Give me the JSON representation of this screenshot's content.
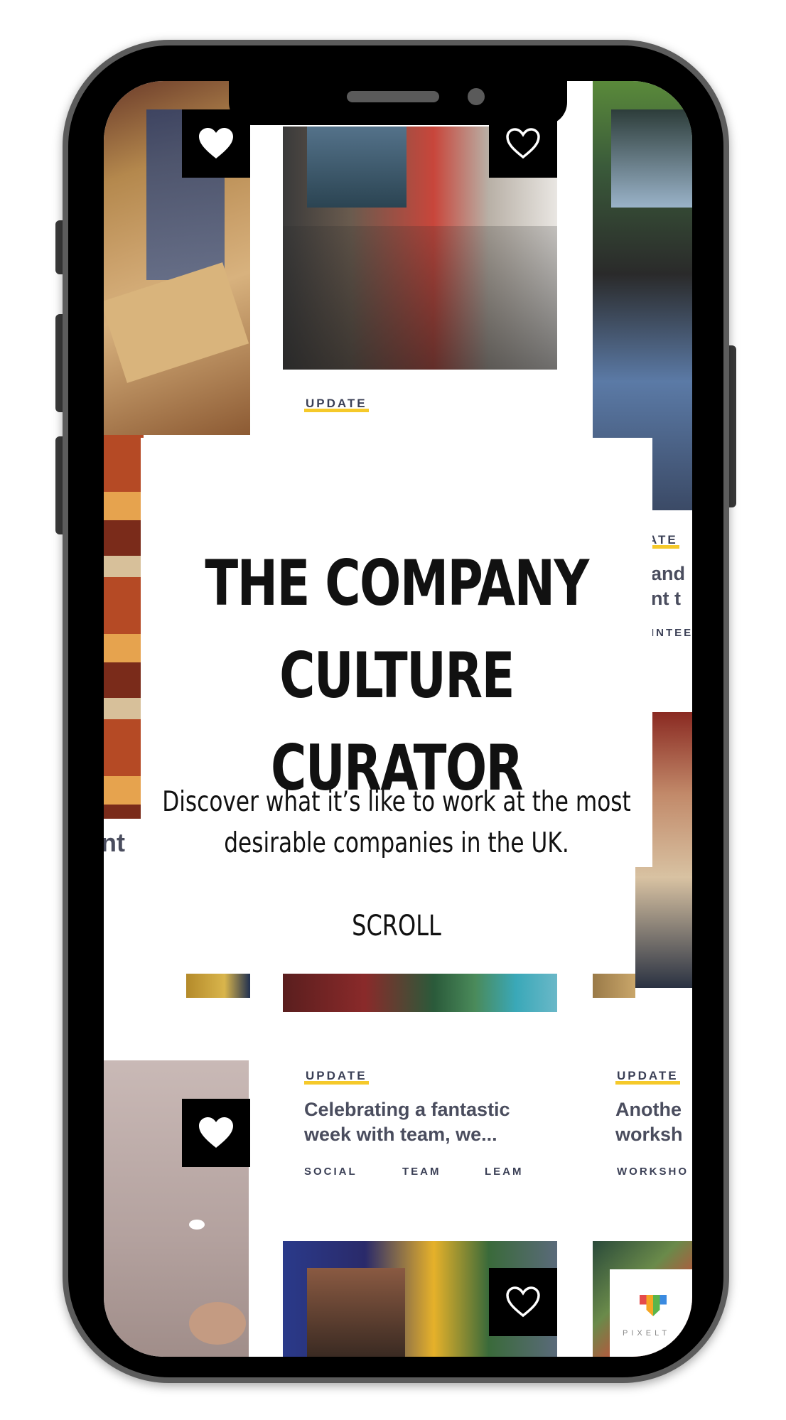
{
  "hero": {
    "title_line1": "THE COMPANY",
    "title_line2": "CULTURE CURATOR",
    "subtitle_line1": "Discover what it’s like to work at the most",
    "subtitle_line2": "desirable companies in the UK.",
    "scroll_label": "SCROLL"
  },
  "top_card": {
    "tag": "UPDATE"
  },
  "right_card_top": {
    "tag": "ATE",
    "title_line1": "and",
    "title_line2": "nt t",
    "category": "INTEE"
  },
  "left_fragment": {
    "text": "nt"
  },
  "middle_card": {
    "tag": "UPDATE",
    "title_line1": "Celebrating a fantastic",
    "title_line2": "week with team, we...",
    "categories": [
      "SOCIAL",
      "TEAM",
      "LEAM"
    ]
  },
  "right_card_bottom": {
    "tag": "UPDATE",
    "title_line1": "Anothe",
    "title_line2": "worksh",
    "category": "WORKSHO"
  },
  "logo": {
    "text": "PIXELT"
  },
  "colors": {
    "accent_yellow": "#f5c92a",
    "text_dark": "#3a3f55",
    "heart_box": "#000000"
  },
  "icons": {
    "heart_filled": "heart-filled-icon",
    "heart_outline": "heart-outline-icon"
  }
}
